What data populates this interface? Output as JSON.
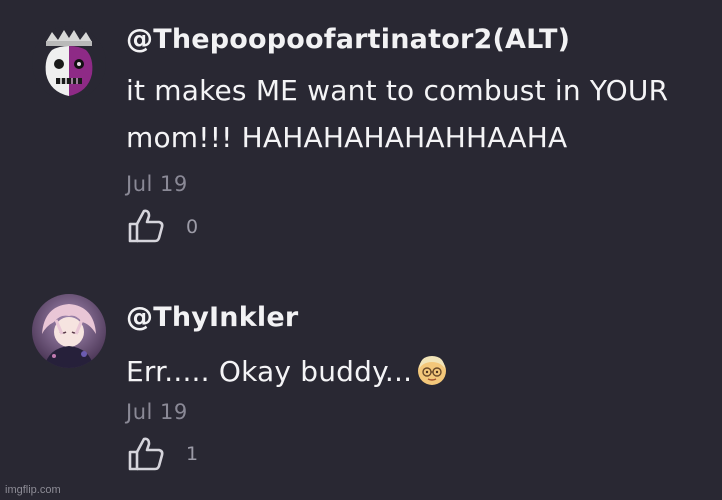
{
  "comments": [
    {
      "username": "@Thepoopoofartinator2(ALT)",
      "text_lines": [
        "it makes ME want to combust in YOUR",
        "mom!!! HAHAHAHAHAHHAAHA"
      ],
      "date": "Jul 19",
      "likes": "0",
      "avatar_icon": "split-face-crown-avatar",
      "like_icon": "thumbs-up-icon"
    },
    {
      "username": "@ThyInkler",
      "text_lines": [
        "Err..... Okay buddy..."
      ],
      "emoji": "older-adult-emoji",
      "date": "Jul 19",
      "likes": "1",
      "avatar_icon": "anime-character-avatar",
      "like_icon": "thumbs-up-icon"
    }
  ],
  "watermark": "imgflip.com",
  "colors": {
    "background": "#292833",
    "text": "#f4f4f6",
    "muted": "#8a8996"
  }
}
